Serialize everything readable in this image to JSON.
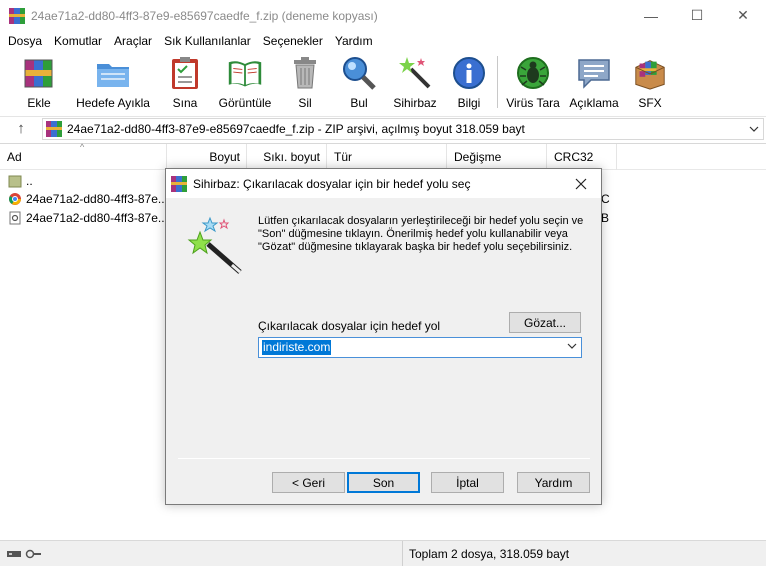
{
  "window": {
    "title": "24ae71a2-dd80-4ff3-87e9-e85697caedfe_f.zip (deneme kopyası)",
    "minimize": "—",
    "maximize": "☐",
    "close": "✕"
  },
  "menu": [
    {
      "label": "Dosya"
    },
    {
      "label": "Komutlar"
    },
    {
      "label": "Araçlar"
    },
    {
      "label": "Sık Kullanılanlar"
    },
    {
      "label": "Seçenekler"
    },
    {
      "label": "Yardım"
    }
  ],
  "toolbar": [
    {
      "label": "Ekle",
      "icon": "add-archive-icon"
    },
    {
      "label": "Hedefe Ayıkla",
      "icon": "extract-folder-icon"
    },
    {
      "label": "Sına",
      "icon": "test-clipboard-icon"
    },
    {
      "label": "Görüntüle",
      "icon": "view-book-icon"
    },
    {
      "label": "Sil",
      "icon": "trash-icon"
    },
    {
      "label": "Bul",
      "icon": "magnifier-icon"
    },
    {
      "label": "Sihirbaz",
      "icon": "wizard-wand-icon"
    },
    {
      "label": "Bilgi",
      "icon": "info-icon"
    },
    {
      "label": "Virüs Tara",
      "icon": "virus-scan-icon"
    },
    {
      "label": "Açıklama",
      "icon": "comment-icon"
    },
    {
      "label": "SFX",
      "icon": "sfx-box-icon"
    }
  ],
  "address": {
    "up": "↑",
    "path": "24ae71a2-dd80-4ff3-87e9-e85697caedfe_f.zip - ZIP arşivi, açılmış boyut 318.059 bayt"
  },
  "columns": [
    "Ad",
    "Boyut",
    "Sıkı. boyut",
    "Tür",
    "Değişme",
    "CRC32"
  ],
  "files": [
    {
      "name": ".."
    },
    {
      "name": "24ae71a2-dd80-4ff3-87e...",
      "crc_tail": "C"
    },
    {
      "name": "24ae71a2-dd80-4ff3-87e...",
      "crc_tail": "B"
    }
  ],
  "status": {
    "summary": "Toplam 2 dosya, 318.059 bayt"
  },
  "dialog": {
    "title": "Sihirbaz:  Çıkarılacak dosyalar için bir hedef yolu seç",
    "description": "Lütfen çıkarılacak dosyaların yerleştirileceği bir hedef yolu seçin ve \"Son\" düğmesine tıklayın. Önerilmiş hedef yolu kullanabilir veya \"Gözat\" düğmesine tıklayarak başka bir hedef yolu seçebilirsiniz.",
    "browse": "Gözat...",
    "dest_label": "Çıkarılacak dosyalar için hedef yol",
    "dest_value": "indiriste.com",
    "buttons": {
      "back": "< Geri",
      "finish": "Son",
      "cancel": "İptal",
      "help": "Yardım"
    }
  },
  "colors": {
    "accent": "#0078d7",
    "dialog_bg": "#f0f0f0"
  }
}
